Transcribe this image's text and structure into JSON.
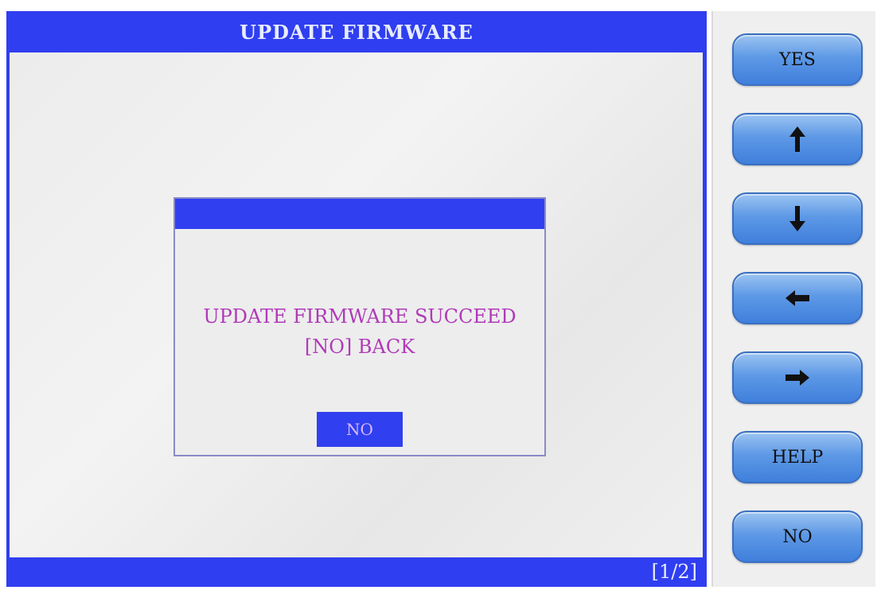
{
  "screen": {
    "title": "UPDATE FIRMWARE",
    "page_indicator": "[1/2]"
  },
  "dialog": {
    "message_line1": "UPDATE FIRMWARE SUCCEED",
    "message_line2": "[NO] BACK",
    "no_label": "NO"
  },
  "side_panel": {
    "yes_label": "YES",
    "up_icon": "arrow-up-icon",
    "down_icon": "arrow-down-icon",
    "left_icon": "arrow-left-icon",
    "right_icon": "arrow-right-icon",
    "help_label": "HELP",
    "no_label": "NO"
  },
  "colors": {
    "frame_blue": "#2f3ef0",
    "message_text": "#b03ab8",
    "button_blue": "#5e99e6"
  }
}
